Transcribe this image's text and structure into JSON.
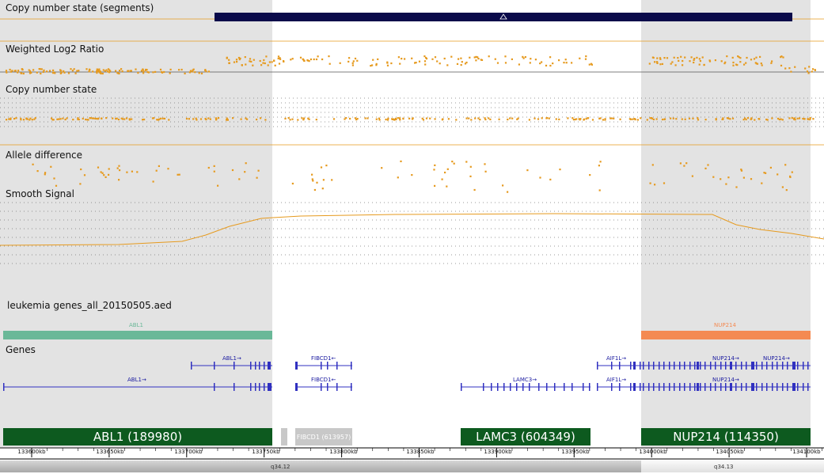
{
  "colors": {
    "shade": "#e3e3e3",
    "orange": "#e69a1e",
    "segment_bar": "#0a0a4a",
    "gene_blue": "#3030c0",
    "omim_green": "#0d5a1f",
    "abl1_bed": "#6ab898",
    "nup214_bed": "#f48a52",
    "fibcd1_grey": "#c8c8c8"
  },
  "tracks": {
    "segments": {
      "label": "Copy number state (segments)",
      "marker_icon": "triangle-up-icon"
    },
    "log2": {
      "label": "Weighted Log2 Ratio"
    },
    "cn_state": {
      "label": "Copy number state"
    },
    "allele": {
      "label": "Allele difference"
    },
    "smooth": {
      "label": "Smooth Signal"
    },
    "aed": {
      "label": "leukemia genes_all_20150505.aed",
      "features": [
        {
          "name": "ABL1"
        },
        {
          "name": "NUP214"
        }
      ]
    },
    "genes": {
      "label": "Genes",
      "features": [
        {
          "name": "ABL1→"
        },
        {
          "name": "ABL1→"
        },
        {
          "name": "FIBCD1←"
        },
        {
          "name": "FIBCD1←"
        },
        {
          "name": "LAMC3→"
        },
        {
          "name": "AIF1L→"
        },
        {
          "name": "AIF1L→"
        },
        {
          "name": "NUP214→"
        },
        {
          "name": "NUP214→"
        },
        {
          "name": "NUP214→"
        }
      ]
    },
    "omim": [
      {
        "label": "ABL1 (189980)"
      },
      {
        "label": "FIBCD1 (613957)"
      },
      {
        "label": "LAMC3 (604349)"
      },
      {
        "label": "NUP214 (114350)"
      }
    ]
  },
  "ruler": {
    "ticks": [
      "133600kb",
      "133650kb",
      "133700kb",
      "133750kb",
      "133800kb",
      "133850kb",
      "133900kb",
      "133950kb",
      "134000kb",
      "134050kb",
      "134100kb"
    ],
    "bands": [
      "q34.12",
      "q34.13"
    ]
  }
}
